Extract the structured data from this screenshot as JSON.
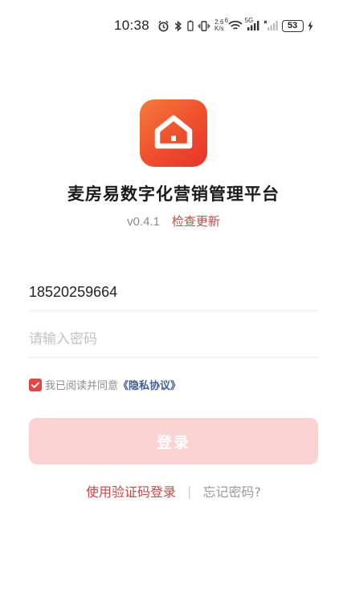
{
  "status_bar": {
    "time": "10:38",
    "net_speed_value": "2.6",
    "net_speed_unit": "K/s",
    "wifi_badge": "6",
    "signal_badge": "5G",
    "battery": "53"
  },
  "app": {
    "title": "麦房易数字化营销管理平台",
    "version": "v0.4.1",
    "check_update_label": "检查更新"
  },
  "form": {
    "phone_value": "18520259664",
    "password_placeholder": "请输入密码",
    "agree_text": "我已阅读并同意",
    "privacy_link": "《隐私协议》",
    "agree_checked": true,
    "login_label": "登录"
  },
  "links": {
    "sms_login": "使用验证码登录",
    "divider": "|",
    "forgot_password": "忘记密码?"
  },
  "colors": {
    "accent": "#c64a45",
    "logo_gradient_start": "#f47a3a",
    "logo_gradient_end": "#e8332a",
    "login_button_disabled": "#fbd3d3",
    "checkbox": "#e64545",
    "privacy_link": "#3e5f96"
  },
  "icons": {
    "logo": "house-icon",
    "alarm": "alarm-icon",
    "bluetooth": "bluetooth-icon",
    "vibrate": "vibrate-icon",
    "wifi": "wifi-icon",
    "signal": "signal-icon",
    "charging": "charging-icon"
  }
}
